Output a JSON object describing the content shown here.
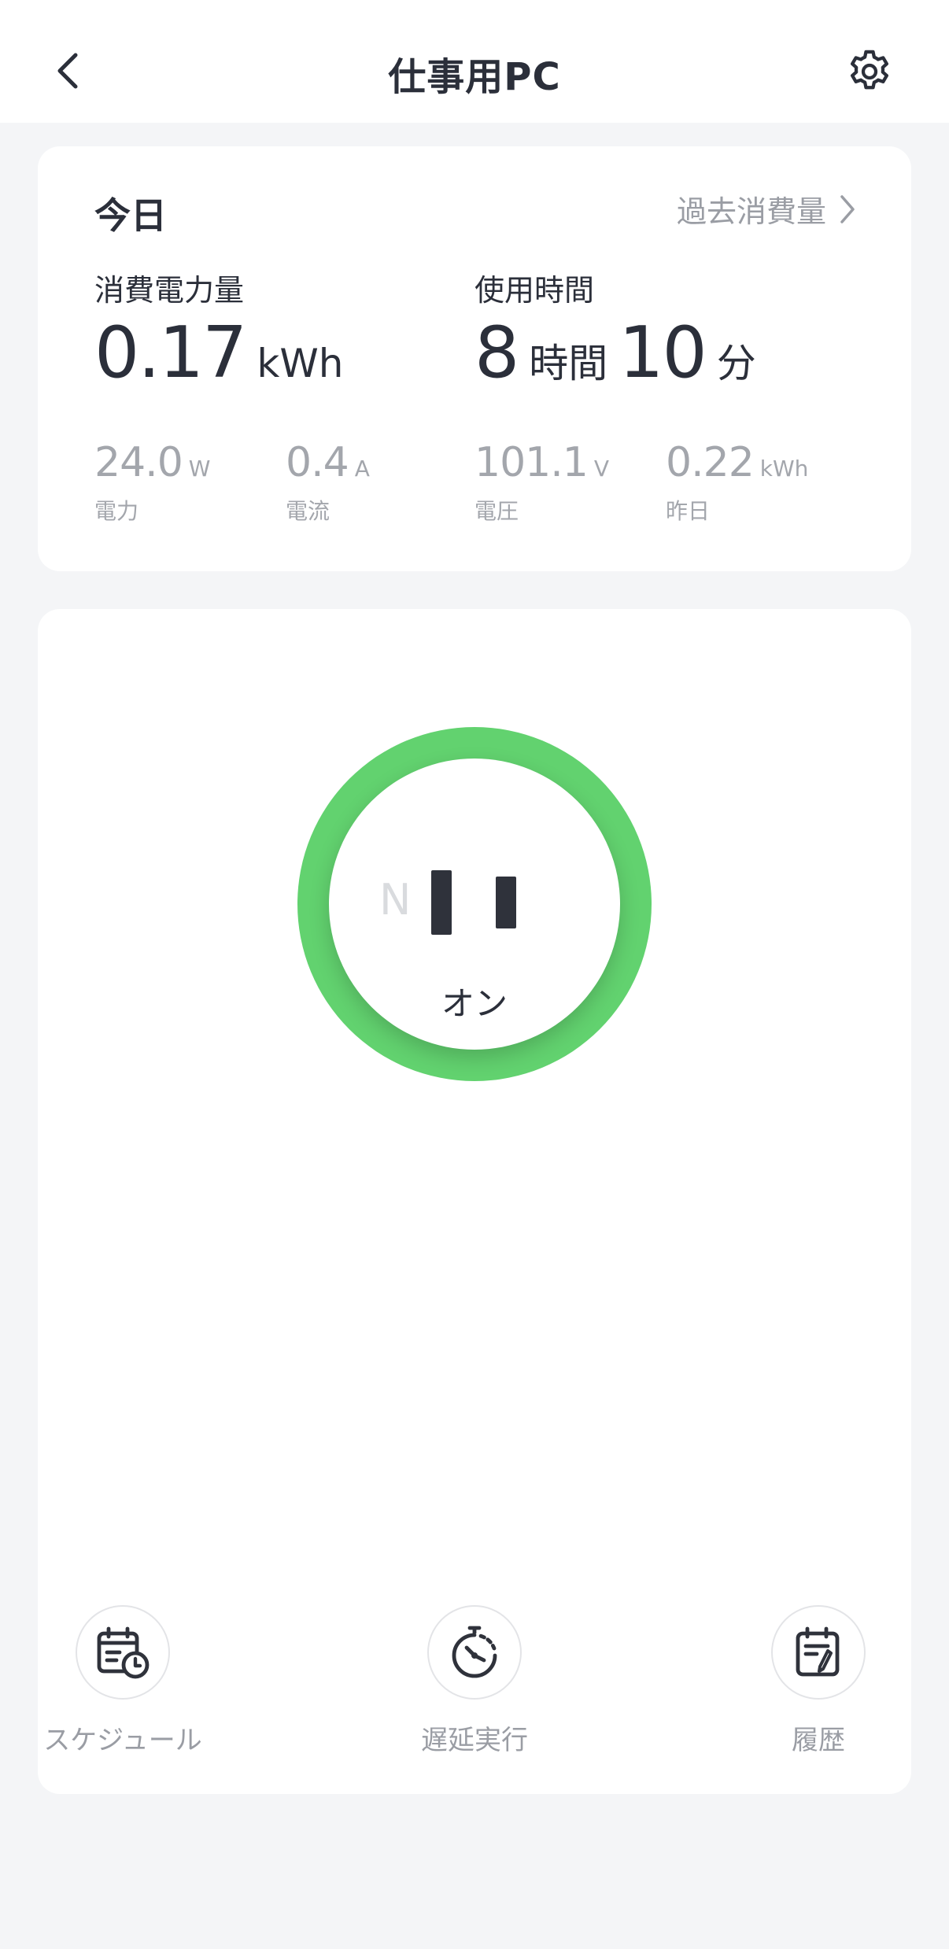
{
  "header": {
    "title": "仕事用PC",
    "back_icon": "chevron-left-icon",
    "settings_icon": "gear-icon"
  },
  "energy": {
    "period_label": "今日",
    "history_link": "過去消費量",
    "consumption": {
      "label": "消費電力量",
      "value": "0.17",
      "unit": "kWh"
    },
    "usage_time": {
      "label": "使用時間",
      "hours": "8",
      "hours_unit": "時間",
      "minutes": "10",
      "minutes_unit": "分"
    },
    "sub_metrics": [
      {
        "value": "24.0",
        "unit": "W",
        "label": "電力"
      },
      {
        "value": "0.4",
        "unit": "A",
        "label": "電流"
      },
      {
        "value": "101.1",
        "unit": "V",
        "label": "電圧"
      },
      {
        "value": "0.22",
        "unit": "kWh",
        "label": "昨日"
      }
    ]
  },
  "switch": {
    "n_letter": "N",
    "state_label": "オン",
    "ring_color": "#62d26f"
  },
  "actions": [
    {
      "label": "スケジュール",
      "icon": "schedule-calendar-icon"
    },
    {
      "label": "遅延実行",
      "icon": "timer-icon"
    },
    {
      "label": "履歴",
      "icon": "history-notepad-icon"
    }
  ]
}
